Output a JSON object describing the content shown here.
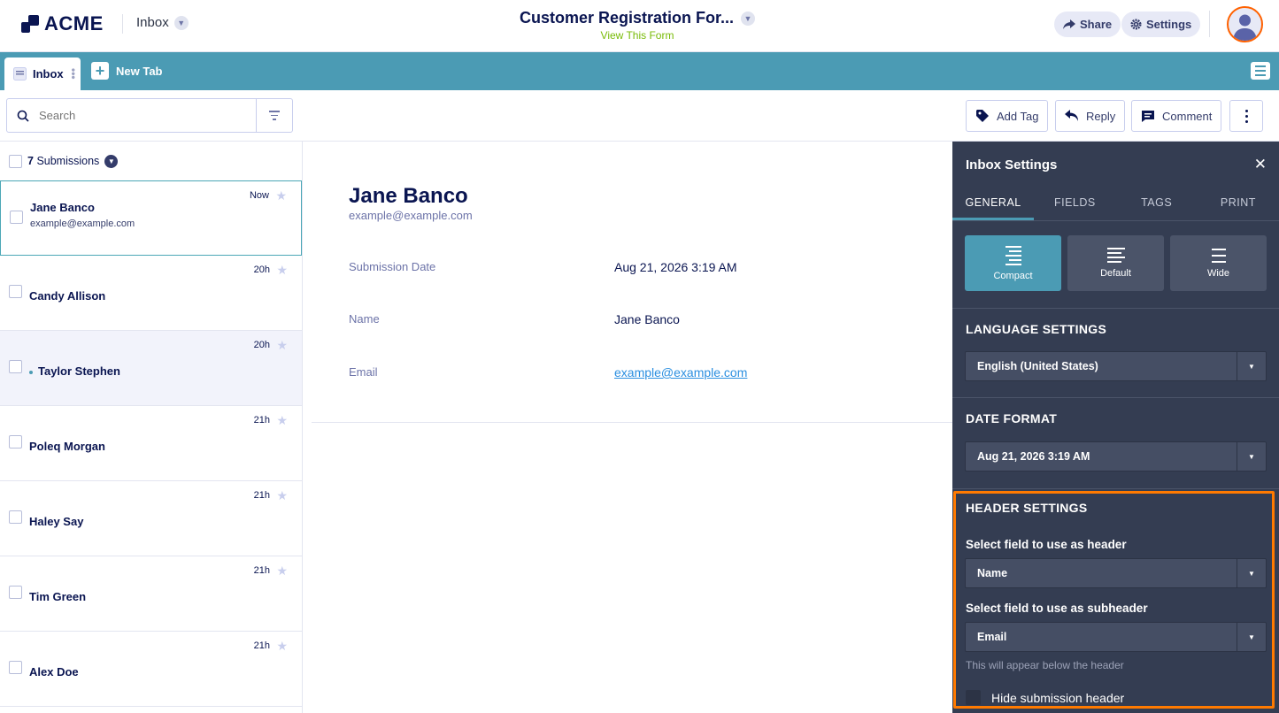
{
  "header": {
    "logo_text": "ACME",
    "app_name": "Inbox",
    "form_title": "Customer Registration For...",
    "view_form_link": "View This Form",
    "share_label": "Share",
    "settings_label": "Settings"
  },
  "tabs": {
    "inbox_label": "Inbox",
    "new_tab_label": "New Tab"
  },
  "toolbar": {
    "search_placeholder": "Search",
    "add_tag_label": "Add Tag",
    "reply_label": "Reply",
    "comment_label": "Comment"
  },
  "list": {
    "count": "7",
    "count_label": "Submissions",
    "items": [
      {
        "name": "Jane Banco",
        "email": "example@example.com",
        "time": "Now"
      },
      {
        "name": "Candy Allison",
        "time": "20h"
      },
      {
        "name": "Taylor Stephen",
        "time": "20h"
      },
      {
        "name": "Poleq Morgan",
        "time": "21h"
      },
      {
        "name": "Haley Say",
        "time": "21h"
      },
      {
        "name": "Tim Green",
        "time": "21h"
      },
      {
        "name": "Alex Doe",
        "time": "21h"
      }
    ]
  },
  "detail": {
    "name": "Jane Banco",
    "email": "example@example.com",
    "fields": [
      {
        "label": "Submission Date",
        "value": "Aug 21, 2026 3:19 AM"
      },
      {
        "label": "Name",
        "value": "Jane Banco"
      },
      {
        "label": "Email",
        "value": "example@example.com"
      }
    ]
  },
  "settings_panel": {
    "title": "Inbox Settings",
    "tabs": [
      "GENERAL",
      "FIELDS",
      "TAGS",
      "PRINT"
    ],
    "views": [
      "Compact",
      "Default",
      "Wide"
    ],
    "language_heading": "LANGUAGE SETTINGS",
    "language_value": "English (United States)",
    "date_heading": "DATE FORMAT",
    "date_value": "Aug 21, 2026 3:19 AM",
    "header_heading": "HEADER SETTINGS",
    "header_field_label": "Select field to use as header",
    "header_field_value": "Name",
    "subheader_field_label": "Select field to use as subheader",
    "subheader_field_value": "Email",
    "subheader_help": "This will appear below the header",
    "hide_header_label": "Hide submission header"
  },
  "colors": {
    "accent": "#4b9bb4",
    "brand_navy": "#0a1551",
    "panel_bg": "#343d52",
    "highlight_border": "#ff7a00",
    "view_link": "#78bb07"
  }
}
